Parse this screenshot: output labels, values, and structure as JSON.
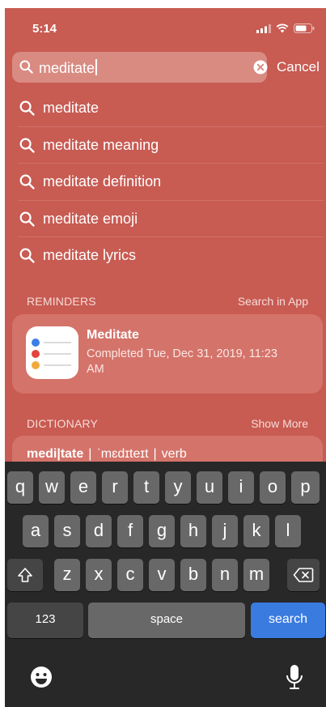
{
  "status_bar": {
    "time": "5:14"
  },
  "search": {
    "query": "meditate",
    "cancel_label": "Cancel"
  },
  "suggestions": [
    {
      "prefix": "meditate",
      "rest": ""
    },
    {
      "prefix": "meditate",
      "rest": " meaning"
    },
    {
      "prefix": "meditate",
      "rest": " definition"
    },
    {
      "prefix": "meditate",
      "rest": " emoji"
    },
    {
      "prefix": "meditate",
      "rest": " lyrics"
    }
  ],
  "reminders": {
    "section_title": "REMINDERS",
    "action_label": "Search in App",
    "item": {
      "title": "Meditate",
      "subtitle": "Completed Tue, Dec 31, 2019, 11:23 AM"
    },
    "icon_name": "reminders-app-icon"
  },
  "dictionary": {
    "section_title": "DICTIONARY",
    "action_label": "Show More",
    "word": "medi|tate",
    "pronunciation": "ˈmɛdɪteɪt",
    "part_of_speech": "verb"
  },
  "keyboard": {
    "row1": [
      "q",
      "w",
      "e",
      "r",
      "t",
      "y",
      "u",
      "i",
      "o",
      "p"
    ],
    "row2": [
      "a",
      "s",
      "d",
      "f",
      "g",
      "h",
      "j",
      "k",
      "l"
    ],
    "row3": [
      "z",
      "x",
      "c",
      "v",
      "b",
      "n",
      "m"
    ],
    "numbers_label": "123",
    "space_label": "space",
    "search_label": "search"
  },
  "colors": {
    "background": "#c85b52",
    "card": "#d4736a",
    "keyboard": "#282828",
    "key": "#686868",
    "search_key": "#3a7be0"
  }
}
